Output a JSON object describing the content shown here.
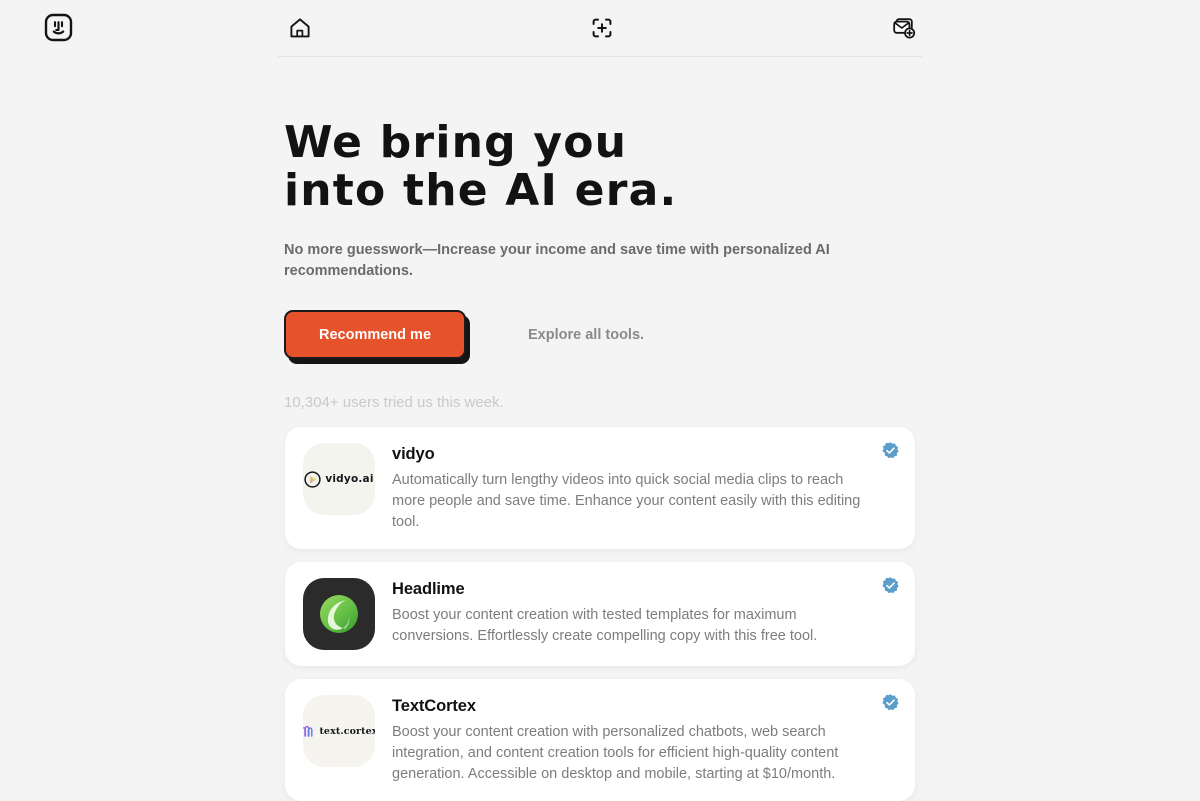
{
  "brand": {
    "logo_icon": "finder-face-icon"
  },
  "nav": {
    "items": [
      {
        "name": "home",
        "icon": "home-icon"
      },
      {
        "name": "add",
        "icon": "plus-square-icon"
      },
      {
        "name": "messages",
        "icon": "mail-add-icon"
      }
    ]
  },
  "hero": {
    "headline": "We bring you\ninto the AI era.",
    "subhead": "No more guesswork—Increase your income and save time with personalized AI recommendations.",
    "cta_label": "Recommend me",
    "explore_label": "Explore all tools.",
    "users_line": "10,304+ users tried us this week."
  },
  "colors": {
    "accent": "#e5522b",
    "background": "#f4f4f4",
    "card": "#ffffff",
    "verified_badge": "#5b9ec9",
    "headline": "#121212",
    "muted_text": "#7d7d7d"
  },
  "cards": [
    {
      "title": "vidyo",
      "desc": "Automatically turn lengthy videos into quick social media clips to reach more people and save time. Enhance your content easily with this editing tool.",
      "logo_text": "vidyo.ai",
      "logo_icon": "vidyo-play-icon",
      "verified": true,
      "verified_icon": "verified-check-icon"
    },
    {
      "title": "Headlime",
      "desc": "Boost your content creation with tested templates for maximum conversions. Effortlessly create compelling copy with this free tool.",
      "logo_text": "",
      "logo_icon": "headlime-lime-icon",
      "verified": true,
      "verified_icon": "verified-check-icon"
    },
    {
      "title": "TextCortex",
      "desc": "Boost your content creation with personalized chatbots, web search integration, and content creation tools for efficient high-quality content generation. Accessible on desktop and mobile, starting at $10/month.",
      "logo_text": "text.cortex",
      "logo_icon": "textcortex-ridge-icon",
      "verified": true,
      "verified_icon": "verified-check-icon"
    }
  ]
}
